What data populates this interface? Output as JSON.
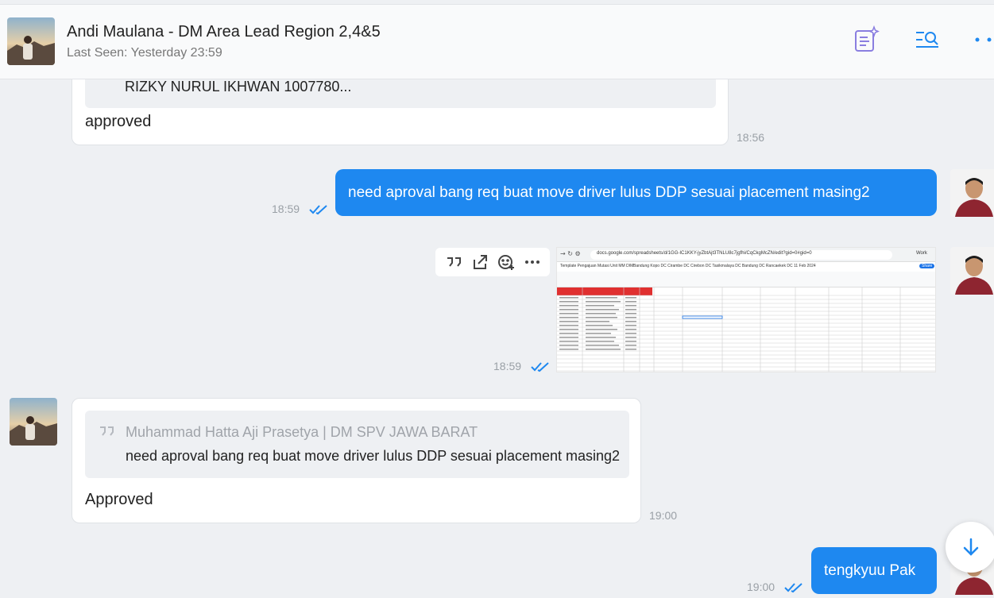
{
  "header": {
    "contact_name": "Andi Maulana - DM Area Lead Region 2,4&5",
    "last_seen": "Last Seen: Yesterday 23:59"
  },
  "messages": [
    {
      "direction": "incoming",
      "quote_text": "RIZKY NURUL IKHWAN 1007780...",
      "text": "approved",
      "time": "18:56"
    },
    {
      "direction": "outgoing",
      "text": "need aproval bang req buat move driver lulus DDP sesuai placement masing2",
      "time": "18:59",
      "read": true
    },
    {
      "direction": "outgoing",
      "type": "image",
      "time": "18:59",
      "read": true,
      "image": {
        "url": "docs.google.com/spreadsheets/d/1GG-IC1KKY-jyZbtAjt3TNLU8c7jgfhi/CqCkgMcZN/edit?gid=0#gid=0",
        "doc_title": "Template Pengajuan Mutasi Unit MM DIM",
        "tabs": "Bandung Kopo DC  Cirambe DC  Cirebon DC  Tasikmalaya DC  Bandung DC  Rancaekek DC 11 Feb 2024",
        "profile": "Work",
        "share": "Share"
      }
    },
    {
      "direction": "incoming",
      "quote_author": "Muhammad Hatta Aji Prasetya | DM SPV JAWA BARAT",
      "quote_text": "need aproval bang req buat move driver lulus DDP sesuai placement masing2",
      "text": "Approved",
      "time": "19:00"
    },
    {
      "direction": "outgoing",
      "text": "tengkyuu Pak",
      "time": "19:00",
      "read": true
    }
  ],
  "icons": {
    "header": [
      "note-sparkle-icon",
      "search-list-icon",
      "more-dots-icon"
    ],
    "actions": [
      "quote-icon",
      "share-icon",
      "emoji-add-icon",
      "more-horizontal-icon"
    ],
    "fab": "arrow-down-icon"
  },
  "colors": {
    "accent": "#1e88f0",
    "bubble_in": "#ffffff",
    "background": "#eef0f3"
  }
}
